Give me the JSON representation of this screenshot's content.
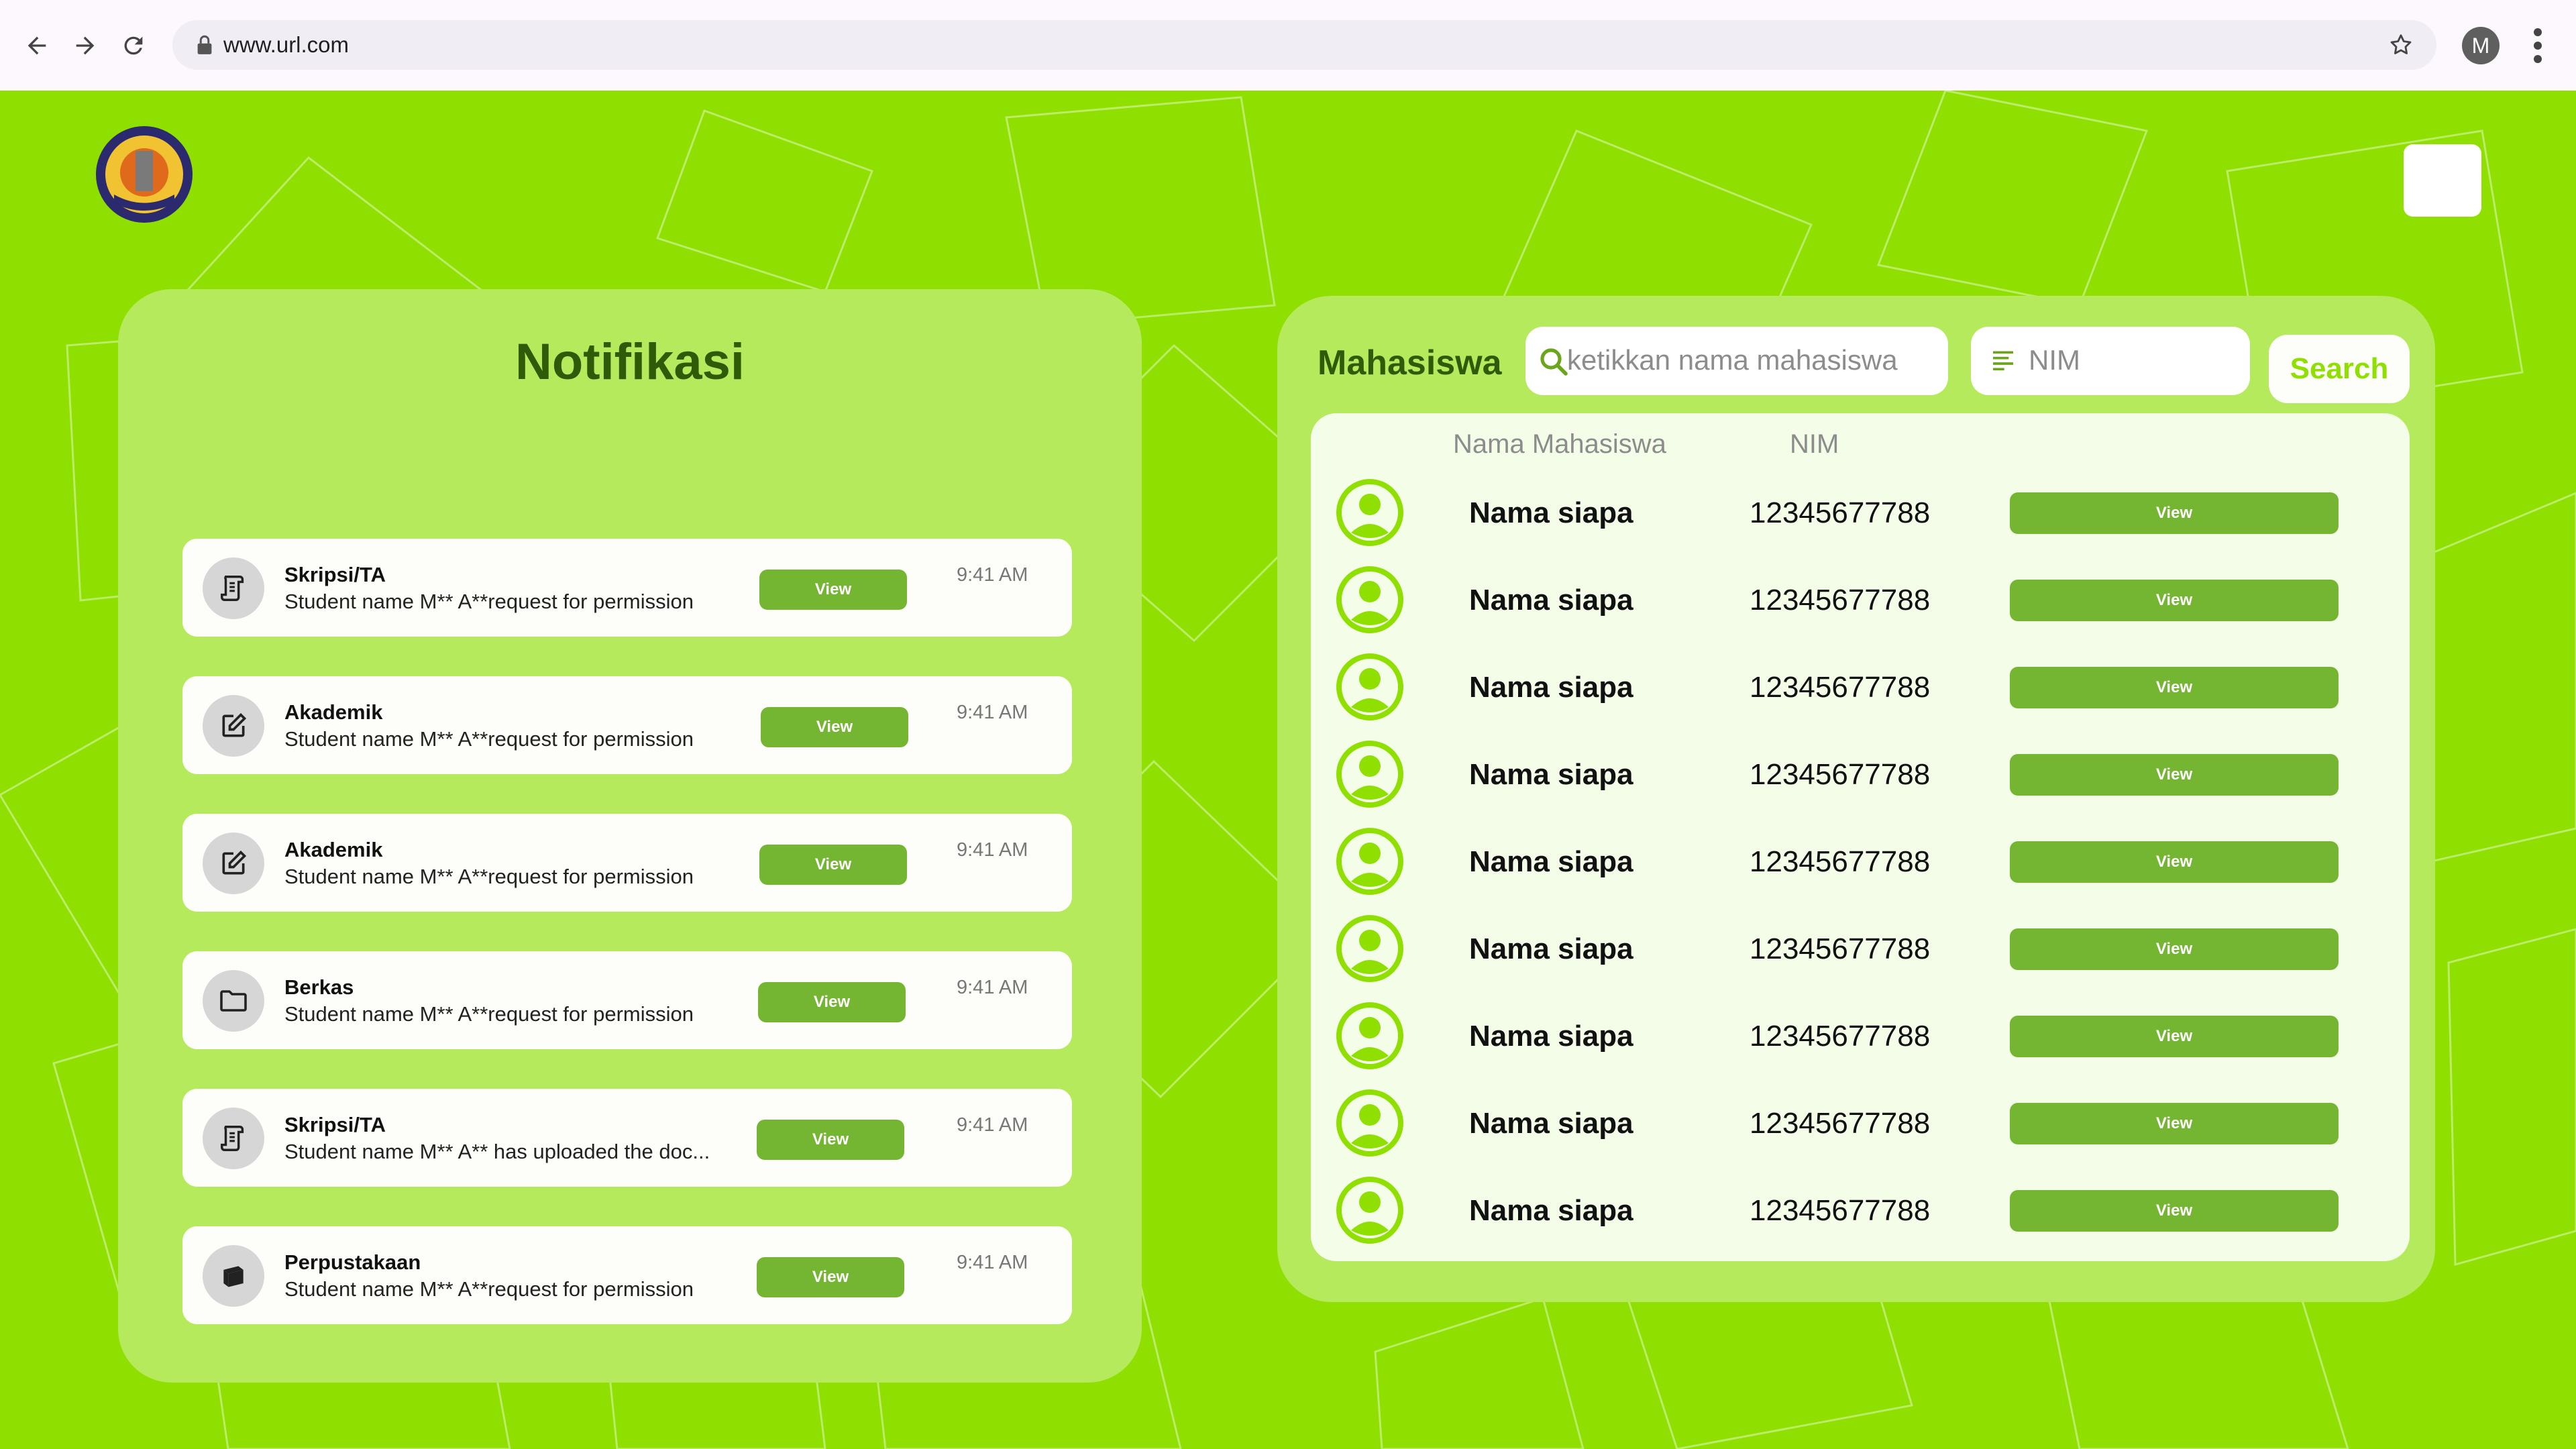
{
  "browser": {
    "url": "www.url.com",
    "profile_initial": "M"
  },
  "colors": {
    "background": "#8fdf00",
    "panel": "#b5ea5c",
    "card": "#fdfefa",
    "button": "#74b531",
    "title": "#2f5a08"
  },
  "notifikasi": {
    "title": "Notifikasi",
    "items": [
      {
        "icon": "scroll-icon",
        "category": "Skripsi/TA",
        "message": "Student name M** A**request for permission",
        "time": "9:41 AM",
        "button": "View"
      },
      {
        "icon": "edit-icon",
        "category": "Akademik",
        "message": "Student name M** A**request for permission",
        "time": "9:41 AM",
        "button": "View"
      },
      {
        "icon": "edit-icon",
        "category": "Akademik",
        "message": "Student name M** A**request for permission",
        "time": "9:41 AM",
        "button": "View"
      },
      {
        "icon": "folder-icon",
        "category": "Berkas",
        "message": "Student name M** A**request for permission",
        "time": "9:41 AM",
        "button": "View"
      },
      {
        "icon": "scroll-icon",
        "category": "Skripsi/TA",
        "message": "Student name M** A** has uploaded the doc...",
        "time": "9:41 AM",
        "button": "View"
      },
      {
        "icon": "book-icon",
        "category": "Perpustakaan",
        "message": "Student name M** A**request for permission",
        "time": "9:41 AM",
        "button": "View"
      }
    ]
  },
  "mahasiswa": {
    "title": "Mahasiswa",
    "search_placeholder": "ketikkan nama mahasiswa",
    "nim_placeholder": "NIM",
    "search_button": "Search",
    "col_name": "Nama Mahasiswa",
    "col_nim": "NIM",
    "rows": [
      {
        "name": "Nama siapa",
        "nim": "12345677788",
        "button": "View"
      },
      {
        "name": "Nama siapa",
        "nim": "12345677788",
        "button": "View"
      },
      {
        "name": "Nama siapa",
        "nim": "12345677788",
        "button": "View"
      },
      {
        "name": "Nama siapa",
        "nim": "12345677788",
        "button": "View"
      },
      {
        "name": "Nama siapa",
        "nim": "12345677788",
        "button": "View"
      },
      {
        "name": "Nama siapa",
        "nim": "12345677788",
        "button": "View"
      },
      {
        "name": "Nama siapa",
        "nim": "12345677788",
        "button": "View"
      },
      {
        "name": "Nama siapa",
        "nim": "12345677788",
        "button": "View"
      },
      {
        "name": "Nama siapa",
        "nim": "12345677788",
        "button": "View"
      }
    ]
  }
}
